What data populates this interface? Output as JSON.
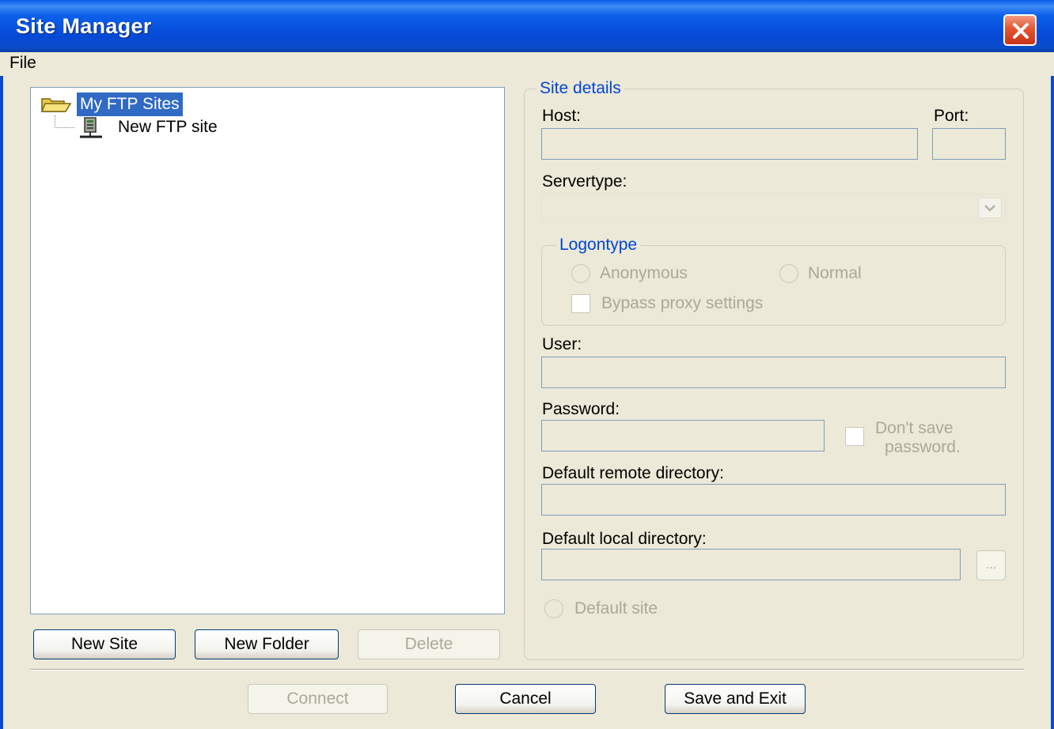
{
  "window": {
    "title": "Site Manager"
  },
  "menu": {
    "file": "File"
  },
  "tree": {
    "root_label": "My FTP Sites",
    "child_label": "New FTP site"
  },
  "left_buttons": {
    "new_site": "New Site",
    "new_folder": "New Folder",
    "delete": "Delete"
  },
  "details": {
    "legend": "Site details",
    "host_label": "Host:",
    "host_value": "",
    "port_label": "Port:",
    "port_value": "",
    "servertype_label": "Servertype:",
    "servertype_value": "",
    "logontype": {
      "legend": "Logontype",
      "anonymous": "Anonymous",
      "normal": "Normal",
      "bypass_proxy": "Bypass proxy settings"
    },
    "user_label": "User:",
    "user_value": "",
    "password_label": "Password:",
    "password_value": "",
    "dont_save_line1": "Don't save",
    "dont_save_line2": "password.",
    "remote_dir_label": "Default remote directory:",
    "remote_dir_value": "",
    "local_dir_label": "Default local directory:",
    "local_dir_value": "",
    "browse_label": "...",
    "default_site": "Default site"
  },
  "bottom_buttons": {
    "connect": "Connect",
    "cancel": "Cancel",
    "save_exit": "Save and Exit"
  },
  "colors": {
    "titlebar": "#0a4ccb",
    "selection": "#316ac5",
    "legend_text": "#0046d5",
    "dialog_bg": "#ece9d8"
  }
}
